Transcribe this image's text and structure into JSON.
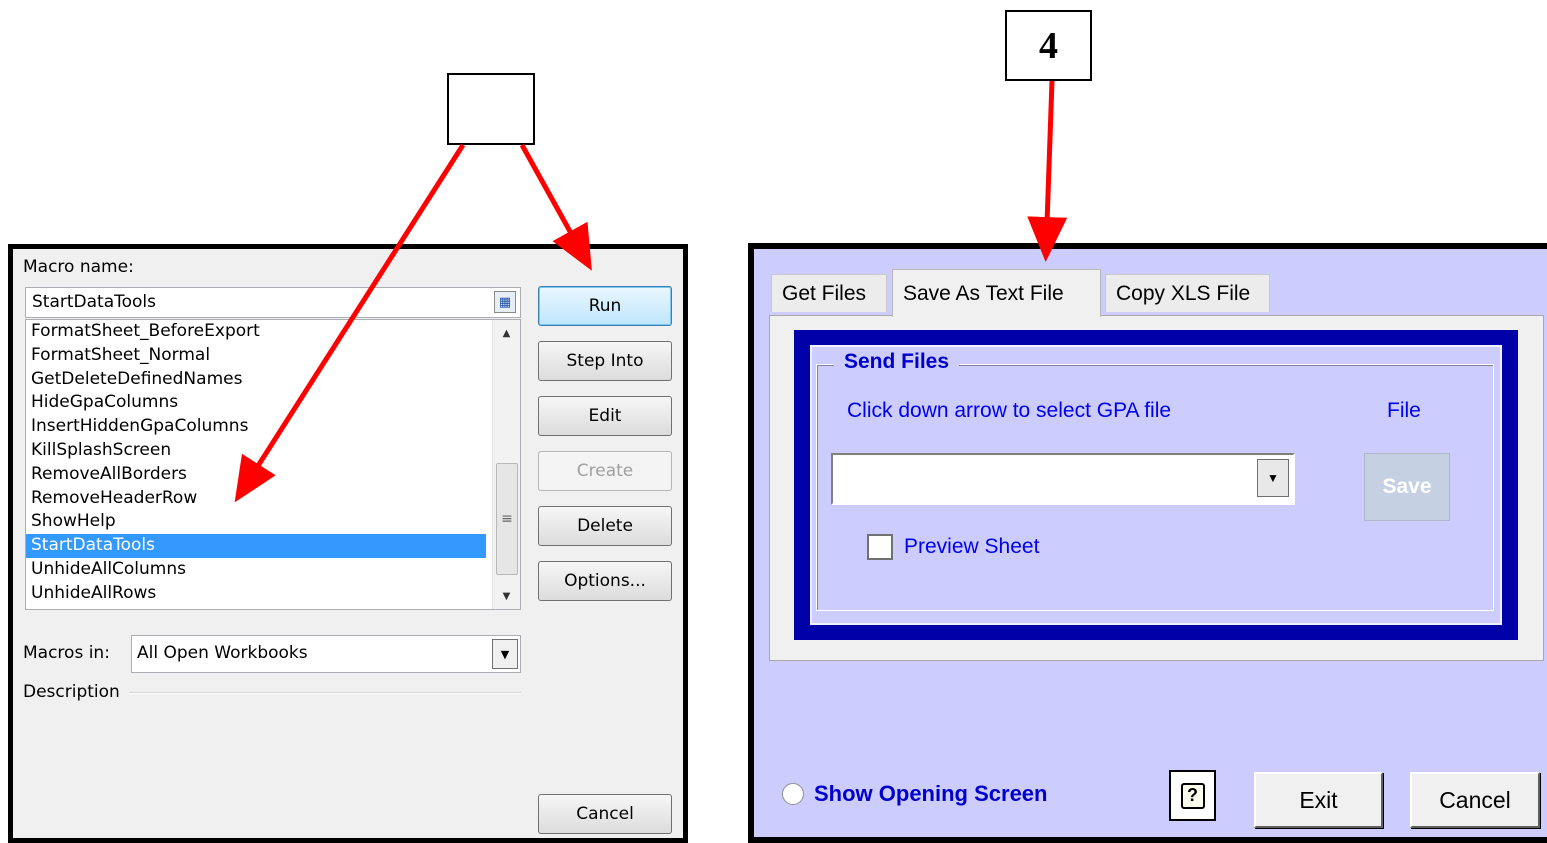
{
  "callouts": {
    "left_label": "",
    "right_label": "4"
  },
  "macro_dialog": {
    "macro_name_label": "Macro name:",
    "macro_name_value": "StartDataTools",
    "macros": [
      "FormatSheet_BeforeExport",
      "FormatSheet_Normal",
      "GetDeleteDefinedNames",
      "HideGpaColumns",
      "InsertHiddenGpaColumns",
      "KillSplashScreen",
      "RemoveAllBorders",
      "RemoveHeaderRow",
      "ShowHelp",
      "StartDataTools",
      "UnhideAllColumns",
      "UnhideAllRows"
    ],
    "selected_macro": "StartDataTools",
    "buttons": {
      "run": "Run",
      "step_into": "Step Into",
      "edit": "Edit",
      "create": "Create",
      "delete": "Delete",
      "options": "Options...",
      "cancel": "Cancel"
    },
    "macros_in_label": "Macros in:",
    "macros_in_value": "All Open Workbooks",
    "description_label": "Description",
    "icons": [
      "ref-edit-icon",
      "scroll-up-icon",
      "scroll-down-icon",
      "dropdown-arrow-icon"
    ]
  },
  "tools_dialog": {
    "tabs": [
      "Get Files",
      "Save As Text File",
      "Copy XLS File"
    ],
    "active_tab": "Save As Text File",
    "group_title": "Send Files",
    "instruction": "Click down arrow to select GPA file",
    "file_label": "File",
    "gpa_select_value": "",
    "save_button": "Save",
    "preview_label": "Preview Sheet",
    "preview_checked": false,
    "show_opening_label": "Show Opening Screen",
    "show_opening_selected": false,
    "help_glyph": "?",
    "exit_button": "Exit",
    "cancel_button": "Cancel",
    "colors": {
      "background": "#ccccff",
      "frame": "#0000a8",
      "label": "#0000ee"
    }
  },
  "annotation_color": "#ff0000"
}
